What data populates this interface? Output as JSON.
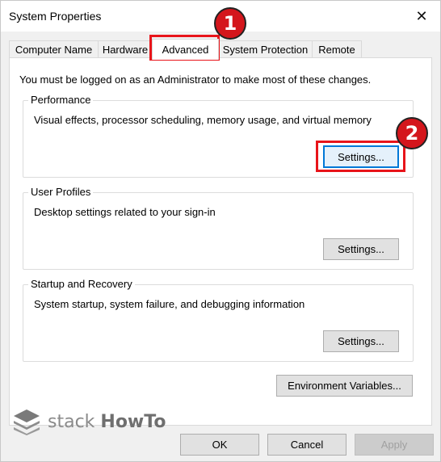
{
  "window": {
    "title": "System Properties",
    "close_glyph": "✕"
  },
  "tabs": [
    {
      "label": "Computer Name",
      "active": false
    },
    {
      "label": "Hardware",
      "active": false
    },
    {
      "label": "Advanced",
      "active": true
    },
    {
      "label": "System Protection",
      "active": false
    },
    {
      "label": "Remote",
      "active": false
    }
  ],
  "admin_note": "You must be logged on as an Administrator to make most of these changes.",
  "performance": {
    "title": "Performance",
    "description": "Visual effects, processor scheduling, memory usage, and virtual memory",
    "button": "Settings..."
  },
  "user_profiles": {
    "title": "User Profiles",
    "description": "Desktop settings related to your sign-in",
    "button": "Settings..."
  },
  "startup_recovery": {
    "title": "Startup and Recovery",
    "description": "System startup, system failure, and debugging information",
    "button": "Settings..."
  },
  "environment_button": "Environment Variables...",
  "footer": {
    "ok": "OK",
    "cancel": "Cancel",
    "apply": "Apply"
  },
  "annotations": {
    "marker_1": "1",
    "marker_2": "2",
    "highlight_color": "#e8141a"
  },
  "watermark": {
    "brand_a": "stack",
    "brand_b": "HowTo",
    "icon": "layers-icon"
  }
}
